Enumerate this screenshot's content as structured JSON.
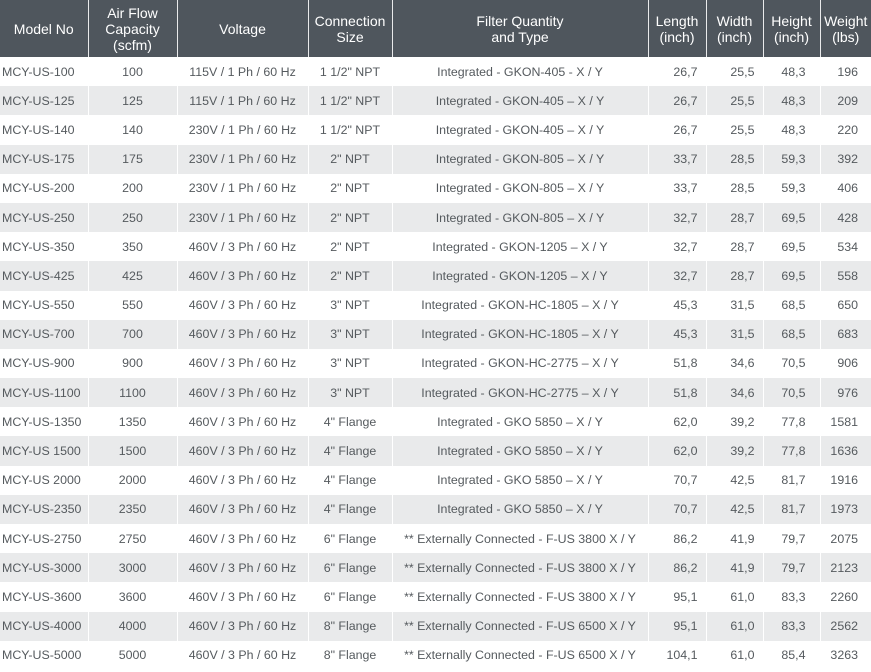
{
  "headers": {
    "model": "Model No",
    "airflow": [
      "Air Flow",
      "Capacity",
      "(scfm)"
    ],
    "voltage": "Voltage",
    "connection": [
      "Connection",
      "Size"
    ],
    "filter": [
      "Filter Quantity",
      "and Type"
    ],
    "length": [
      "Length",
      "(inch)"
    ],
    "width": [
      "Width",
      "(inch)"
    ],
    "height": [
      "Height",
      "(inch)"
    ],
    "weight": [
      "Weight",
      "(lbs)"
    ]
  },
  "rows": [
    {
      "model": "MCY-US-100",
      "airflow": "100",
      "voltage": "115V / 1 Ph / 60 Hz",
      "connection": "1 1/2\" NPT",
      "filter": "Integrated - GKON-405 -  X / Y",
      "length": "26,7",
      "width": "25,5",
      "height": "48,3",
      "weight": "196"
    },
    {
      "model": "MCY-US-125",
      "airflow": "125",
      "voltage": "115V / 1 Ph / 60 Hz",
      "connection": "1 1/2\" NPT",
      "filter": "Integrated - GKON-405 – X / Y",
      "length": "26,7",
      "width": "25,5",
      "height": "48,3",
      "weight": "209"
    },
    {
      "model": "MCY-US-140",
      "airflow": "140",
      "voltage": "230V / 1 Ph / 60 Hz",
      "connection": "1 1/2\" NPT",
      "filter": "Integrated - GKON-405 – X / Y",
      "length": "26,7",
      "width": "25,5",
      "height": "48,3",
      "weight": "220"
    },
    {
      "model": "MCY-US-175",
      "airflow": "175",
      "voltage": "230V / 1 Ph / 60 Hz",
      "connection": "2\" NPT",
      "filter": "Integrated - GKON-805 – X / Y",
      "length": "33,7",
      "width": "28,5",
      "height": "59,3",
      "weight": "392"
    },
    {
      "model": "MCY-US-200",
      "airflow": "200",
      "voltage": "230V / 1 Ph / 60 Hz",
      "connection": "2\" NPT",
      "filter": "Integrated - GKON-805 – X / Y",
      "length": "33,7",
      "width": "28,5",
      "height": "59,3",
      "weight": "406"
    },
    {
      "model": "MCY-US-250",
      "airflow": "250",
      "voltage": "230V / 1 Ph / 60 Hz",
      "connection": "2\" NPT",
      "filter": "Integrated - GKON-805 – X / Y",
      "length": "32,7",
      "width": "28,7",
      "height": "69,5",
      "weight": "428"
    },
    {
      "model": "MCY-US-350",
      "airflow": "350",
      "voltage": "460V / 3 Ph / 60 Hz",
      "connection": "2\" NPT",
      "filter": "Integrated - GKON-1205 – X / Y",
      "length": "32,7",
      "width": "28,7",
      "height": "69,5",
      "weight": "534"
    },
    {
      "model": "MCY-US-425",
      "airflow": "425",
      "voltage": "460V / 3 Ph / 60 Hz",
      "connection": "2\" NPT",
      "filter": "Integrated - GKON-1205 – X / Y",
      "length": "32,7",
      "width": "28,7",
      "height": "69,5",
      "weight": "558"
    },
    {
      "model": "MCY-US-550",
      "airflow": "550",
      "voltage": "460V / 3 Ph / 60 Hz",
      "connection": "3\" NPT",
      "filter": "Integrated - GKON-HC-1805 – X / Y",
      "length": "45,3",
      "width": "31,5",
      "height": "68,5",
      "weight": "650"
    },
    {
      "model": "MCY-US-700",
      "airflow": "700",
      "voltage": "460V / 3 Ph / 60 Hz",
      "connection": "3\" NPT",
      "filter": "Integrated - GKON-HC-1805 – X / Y",
      "length": "45,3",
      "width": "31,5",
      "height": "68,5",
      "weight": "683"
    },
    {
      "model": "MCY-US-900",
      "airflow": "900",
      "voltage": "460V / 3 Ph / 60 Hz",
      "connection": "3\" NPT",
      "filter": "Integrated - GKON-HC-2775 – X / Y",
      "length": "51,8",
      "width": "34,6",
      "height": "70,5",
      "weight": "906"
    },
    {
      "model": "MCY-US-1100",
      "airflow": "1100",
      "voltage": "460V / 3 Ph / 60 Hz",
      "connection": "3\" NPT",
      "filter": "Integrated - GKON-HC-2775 – X / Y",
      "length": "51,8",
      "width": "34,6",
      "height": "70,5",
      "weight": "976"
    },
    {
      "model": "MCY-US-1350",
      "airflow": "1350",
      "voltage": "460V / 3 Ph / 60 Hz",
      "connection": "4\" Flange",
      "filter": "Integrated - GKO 5850 – X / Y",
      "length": "62,0",
      "width": "39,2",
      "height": "77,8",
      "weight": "1581"
    },
    {
      "model": "MCY-US 1500",
      "airflow": "1500",
      "voltage": "460V / 3 Ph / 60 Hz",
      "connection": "4\" Flange",
      "filter": "Integrated - GKO 5850 – X / Y",
      "length": "62,0",
      "width": "39,2",
      "height": "77,8",
      "weight": "1636"
    },
    {
      "model": "MCY-US 2000",
      "airflow": "2000",
      "voltage": "460V / 3 Ph / 60 Hz",
      "connection": "4\" Flange",
      "filter": "Integrated - GKO 5850 – X / Y",
      "length": "70,7",
      "width": "42,5",
      "height": "81,7",
      "weight": "1916"
    },
    {
      "model": "MCY-US-2350",
      "airflow": "2350",
      "voltage": "460V / 3 Ph / 60 Hz",
      "connection": "4\" Flange",
      "filter": "Integrated - GKO 5850 – X / Y",
      "length": "70,7",
      "width": "42,5",
      "height": "81,7",
      "weight": "1973"
    },
    {
      "model": "MCY-US-2750",
      "airflow": "2750",
      "voltage": "460V / 3 Ph / 60 Hz",
      "connection": "6\" Flange",
      "filter": "** Externally Connected - F-US 3800 X / Y",
      "length": "86,2",
      "width": "41,9",
      "height": "79,7",
      "weight": "2075"
    },
    {
      "model": "MCY-US-3000",
      "airflow": "3000",
      "voltage": "460V / 3 Ph / 60 Hz",
      "connection": "6\" Flange",
      "filter": "** Externally Connected - F-US 3800 X / Y",
      "length": "86,2",
      "width": "41,9",
      "height": "79,7",
      "weight": "2123"
    },
    {
      "model": "MCY-US-3600",
      "airflow": "3600",
      "voltage": "460V / 3 Ph / 60 Hz",
      "connection": "6\" Flange",
      "filter": "** Externally Connected - F-US 3800 X / Y",
      "length": "95,1",
      "width": "61,0",
      "height": "83,3",
      "weight": "2260"
    },
    {
      "model": "MCY-US-4000",
      "airflow": "4000",
      "voltage": "460V / 3 Ph / 60 Hz",
      "connection": "8\" Flange",
      "filter": "** Externally Connected - F-US 6500 X / Y",
      "length": "95,1",
      "width": "61,0",
      "height": "83,3",
      "weight": "2562"
    },
    {
      "model": "MCY-US-5000",
      "airflow": "5000",
      "voltage": "460V / 3 Ph / 60 Hz",
      "connection": "8\" Flange",
      "filter": "** Externally Connected - F-US 6500 X / Y",
      "length": "104,1",
      "width": "61,0",
      "height": "85,4",
      "weight": "3263"
    }
  ]
}
